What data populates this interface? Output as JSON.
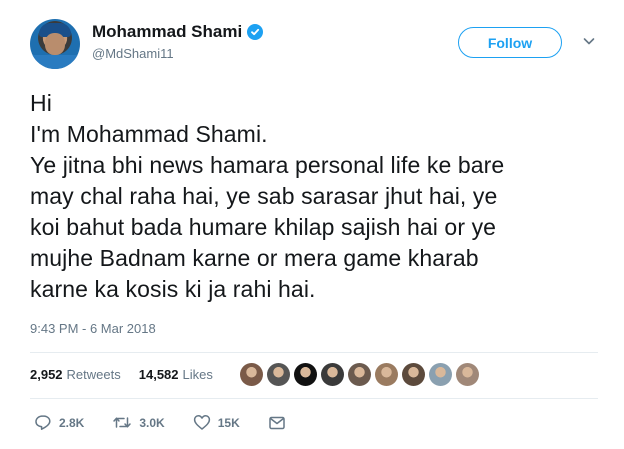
{
  "user": {
    "name": "Mohammad Shami",
    "handle": "@MdShami11"
  },
  "follow_label": "Follow",
  "tweet_lines": [
    "Hi",
    "I'm Mohammad Shami.",
    "Ye jitna bhi news hamara personal life ke bare",
    "may chal raha hai, ye sab sarasar jhut hai, ye",
    "koi bahut bada humare khilap sajish hai or ye",
    "mujhe Badnam karne or mera game kharab",
    "karne ka kosis ki ja rahi hai."
  ],
  "timestamp": "9:43 PM - 6 Mar 2018",
  "stats": {
    "retweets_count": "2,952",
    "retweets_label": "Retweets",
    "likes_count": "14,582",
    "likes_label": "Likes"
  },
  "likers": [
    {
      "icon": "liker-avatar",
      "color": "#7a5a48"
    },
    {
      "icon": "liker-avatar",
      "color": "#555555"
    },
    {
      "icon": "liker-avatar",
      "color": "#111111"
    },
    {
      "icon": "liker-avatar",
      "color": "#3a3a3a"
    },
    {
      "icon": "liker-avatar",
      "color": "#6b5a4e"
    },
    {
      "icon": "liker-avatar",
      "color": "#9a7b60"
    },
    {
      "icon": "liker-avatar",
      "color": "#5c4a3c"
    },
    {
      "icon": "liker-avatar",
      "color": "#8aa0b0"
    },
    {
      "icon": "liker-avatar",
      "color": "#a08878"
    }
  ],
  "actions": {
    "replies": "2.8K",
    "retweets": "3.0K",
    "likes": "15K"
  },
  "colors": {
    "accent": "#1da1f2",
    "text": "#14171a",
    "muted": "#657786"
  }
}
